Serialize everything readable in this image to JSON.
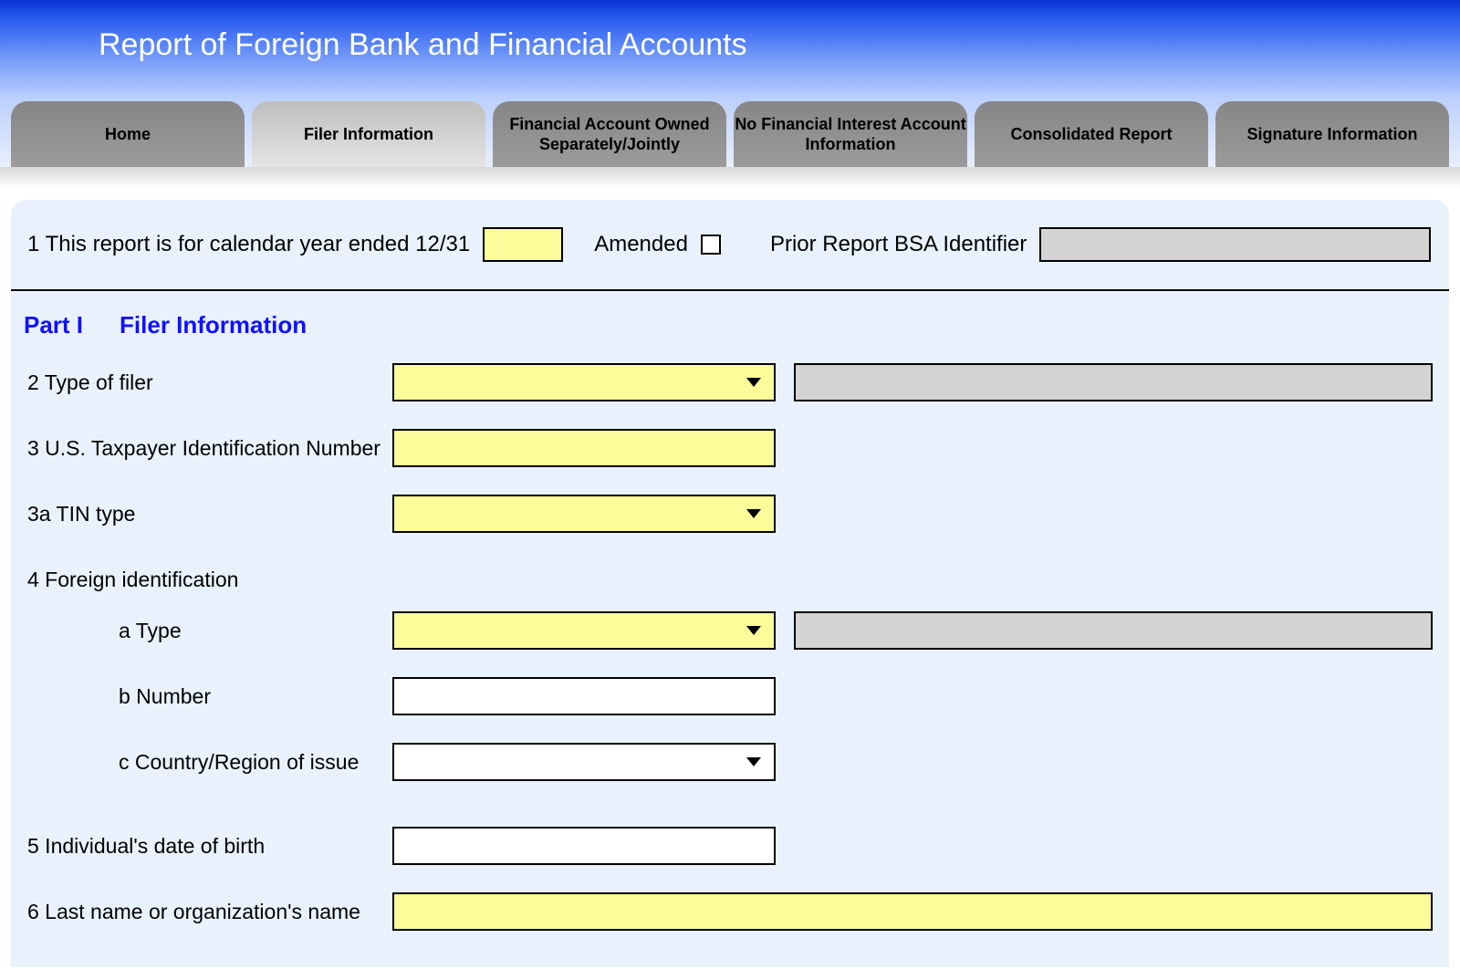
{
  "header": {
    "title": "Report of Foreign Bank and Financial Accounts"
  },
  "tabs": [
    "Home",
    "Filer Information",
    "Financial Account Owned Separately/Jointly",
    "No Financial Interest Account Information",
    "Consolidated Report",
    "Signature Information"
  ],
  "active_tab_index": 1,
  "line1": {
    "label": "1  This report is for calendar year ended 12/31",
    "year_value": "",
    "amended_label": "Amended",
    "amended_checked": false,
    "prior_label": "Prior Report BSA Identifier",
    "prior_value": ""
  },
  "part_title": {
    "part": "Part I",
    "name": "Filer Information"
  },
  "fields": {
    "f2": {
      "label": "2 Type of filer",
      "value": "",
      "extra": ""
    },
    "f3": {
      "label": "3 U.S. Taxpayer Identification Number",
      "value": ""
    },
    "f3a": {
      "label": "3a TIN type",
      "value": ""
    },
    "f4": {
      "label": "4 Foreign identification"
    },
    "f4a": {
      "label": "a Type",
      "value": "",
      "extra": ""
    },
    "f4b": {
      "label": "b Number",
      "value": ""
    },
    "f4c": {
      "label": "c Country/Region of issue",
      "value": ""
    },
    "f5": {
      "label": "5 Individual's date of birth",
      "value": ""
    },
    "f6": {
      "label": "6 Last name  or organization's name",
      "value": ""
    }
  }
}
